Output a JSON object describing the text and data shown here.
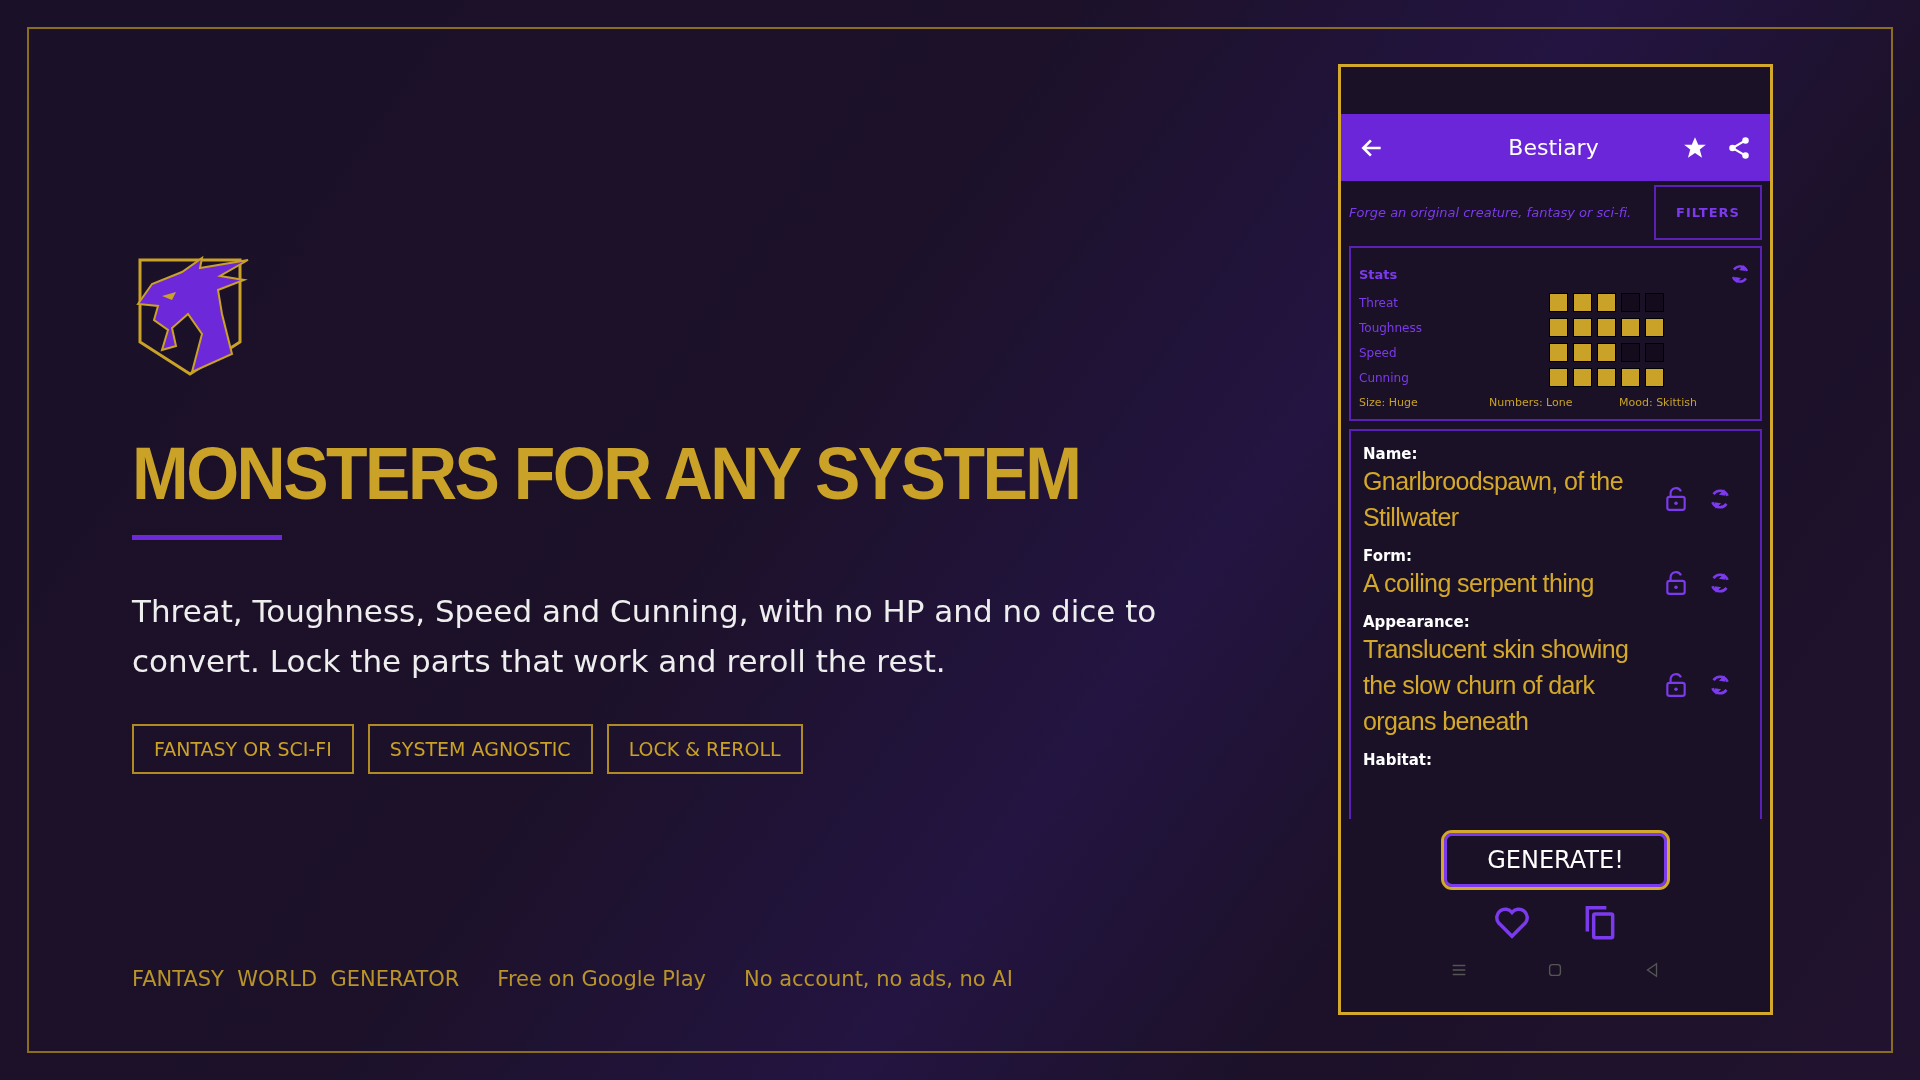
{
  "hero": {
    "title": "MONSTERS FOR ANY SYSTEM",
    "description": "Threat, Toughness, Speed and Cunning, with no HP and no dice to convert. Lock the parts that work and reroll the rest.",
    "tags": [
      "FANTASY OR SCI-FI",
      "SYSTEM AGNOSTIC",
      "LOCK & REROLL"
    ]
  },
  "footer": [
    "FANTASY  WORLD  GENERATOR",
    "Free on Google Play",
    "No account, no ads, no AI"
  ],
  "app": {
    "title": "Bestiary",
    "subtitle": "Forge an original creature, fantasy or sci-fi.",
    "filters_button": "FILTERS",
    "stats": {
      "heading": "Stats",
      "rows": [
        {
          "label": "Threat",
          "stars": 3
        },
        {
          "label": "Toughness",
          "stars": 5
        },
        {
          "label": "Speed",
          "stars": 3
        },
        {
          "label": "Cunning",
          "stars": 5
        }
      ],
      "traits": [
        "Size: Huge",
        "Numbers: Lone",
        "Mood: Skittish"
      ]
    },
    "fields": [
      {
        "label": "Name:",
        "value": "Gnarlbroodspawn, of the Stillwater"
      },
      {
        "label": "Form:",
        "value": "A coiling serpent thing"
      },
      {
        "label": "Appearance:",
        "value": "Translucent skin showing the slow churn of dark organs beneath"
      },
      {
        "label": "Habitat:"
      }
    ],
    "generate_button": "GENERATE!"
  }
}
